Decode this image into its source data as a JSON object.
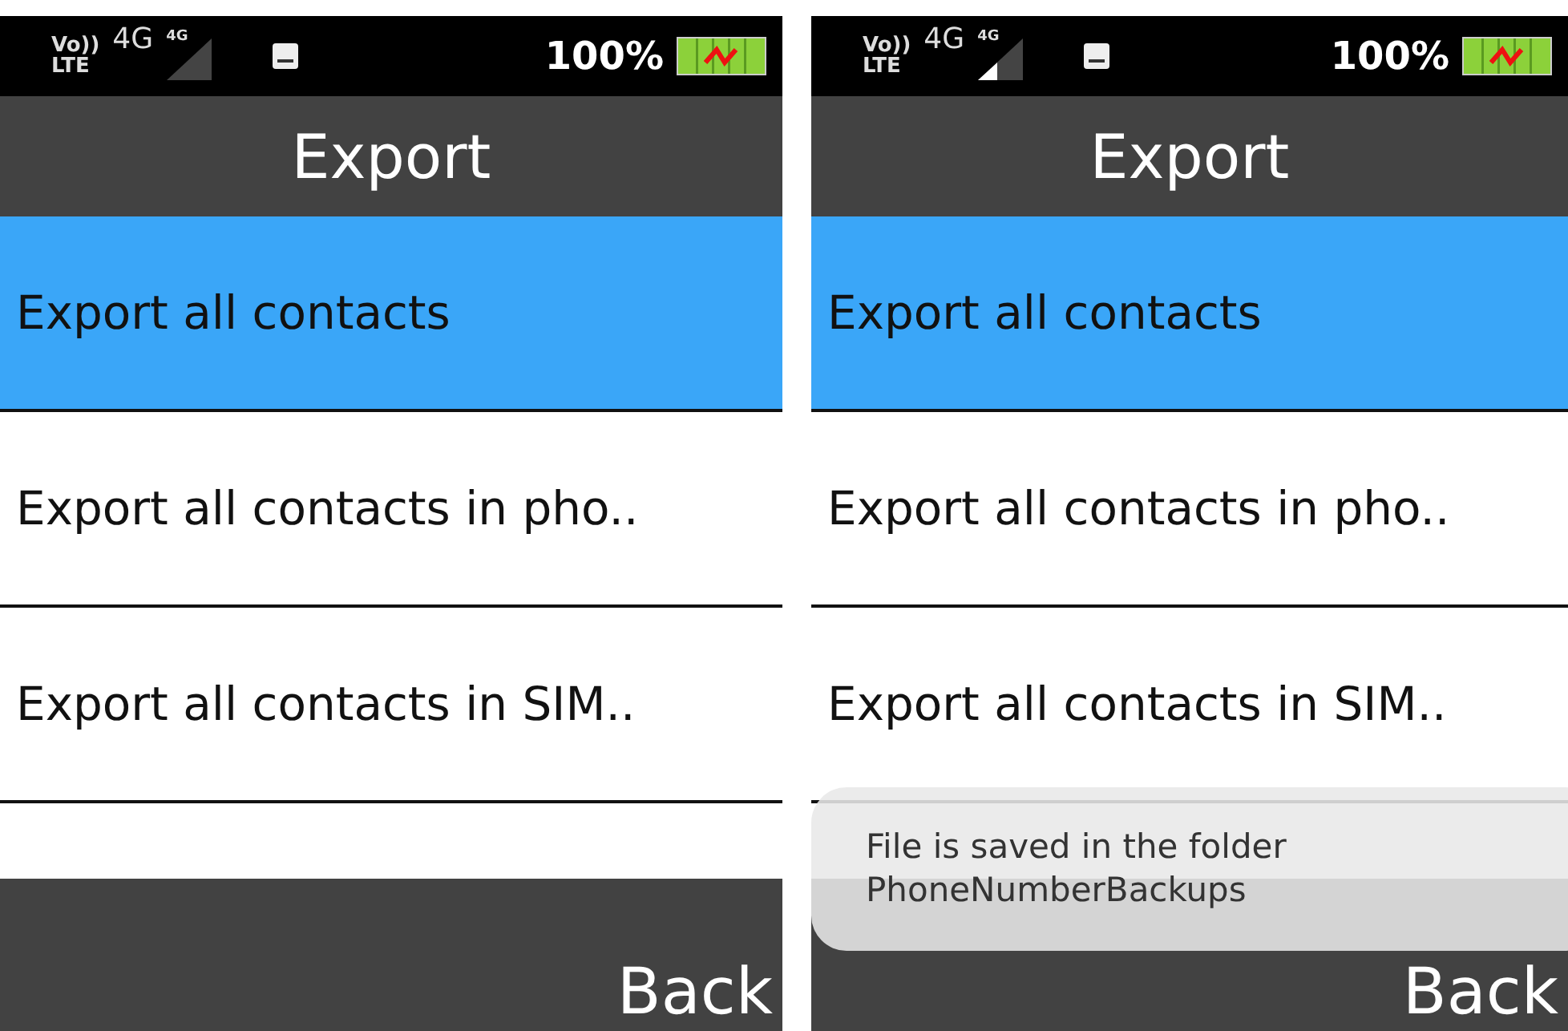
{
  "screens": [
    {
      "status": {
        "volte": "Vo))",
        "lte": "LTE",
        "network": "4G",
        "signal_tag": "4G",
        "signal_partial": false,
        "battery": "100%"
      },
      "title": "Export",
      "items": [
        {
          "label": "Export all contacts",
          "selected": true
        },
        {
          "label": "Export all contacts in pho..",
          "selected": false
        },
        {
          "label": "Export all contacts in SIM..",
          "selected": false
        }
      ],
      "softkey": "Back"
    },
    {
      "status": {
        "volte": "Vo))",
        "lte": "LTE",
        "network": "4G",
        "signal_tag": "4G",
        "signal_partial": true,
        "battery": "100%"
      },
      "title": "Export",
      "items": [
        {
          "label": "Export all contacts",
          "selected": true
        },
        {
          "label": "Export all contacts in pho..",
          "selected": false
        },
        {
          "label": "Export all contacts in SIM..",
          "selected": false
        }
      ],
      "softkey": "Back",
      "toast": "File is saved in the folder PhoneNumberBackups"
    }
  ]
}
